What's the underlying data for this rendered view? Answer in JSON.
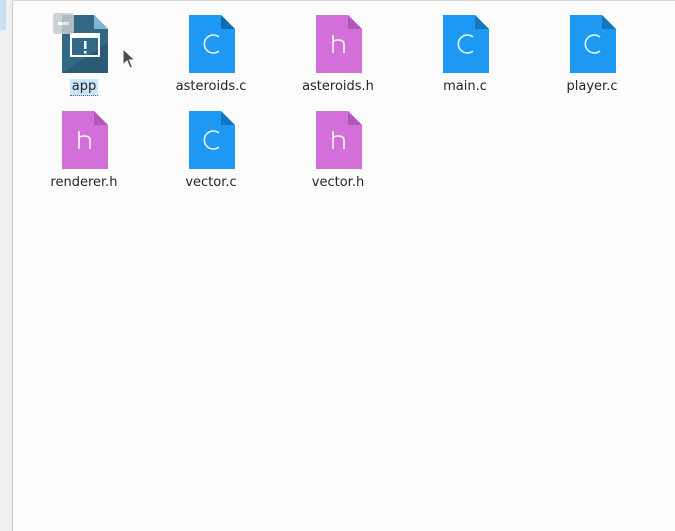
{
  "file_view": {
    "files": [
      {
        "name": "app",
        "type": "executable",
        "icon": "application-icon",
        "selected": true
      },
      {
        "name": "asteroids.c",
        "type": "c-source",
        "icon": "c-source-file-icon",
        "glyph": "C"
      },
      {
        "name": "asteroids.h",
        "type": "c-header",
        "icon": "c-header-file-icon",
        "glyph": "h"
      },
      {
        "name": "main.c",
        "type": "c-source",
        "icon": "c-source-file-icon",
        "glyph": "C"
      },
      {
        "name": "player.c",
        "type": "c-source",
        "icon": "c-source-file-icon",
        "glyph": "C"
      },
      {
        "name": "renderer.h",
        "type": "c-header",
        "icon": "c-header-file-icon",
        "glyph": "h"
      },
      {
        "name": "vector.c",
        "type": "c-source",
        "icon": "c-source-file-icon",
        "glyph": "C"
      },
      {
        "name": "vector.h",
        "type": "c-header",
        "icon": "c-header-file-icon",
        "glyph": "h"
      }
    ]
  },
  "colors": {
    "c_source": "#1d99f3",
    "c_source_fold": "#4fb3f7",
    "c_source_shadow": "#1380cf",
    "c_header": "#d26fd9",
    "c_header_fold": "#e6a3ea",
    "c_header_shadow": "#b655bd",
    "app_dark": "#2b5a75",
    "app_light": "#4a86a8",
    "selection": "#cde3f6"
  }
}
